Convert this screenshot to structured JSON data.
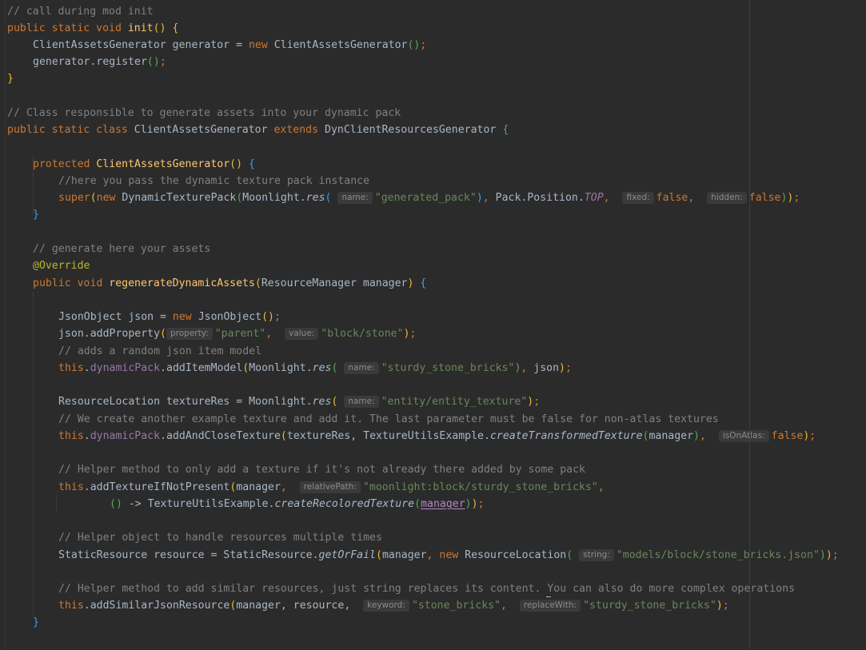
{
  "hints": {
    "name": "name:",
    "fixed": "fixed:",
    "hidden": "hidden:",
    "property": "property:",
    "value": "value:",
    "isOnAtlas": "isOnAtlas:",
    "relativePath": "relativePath:",
    "string": "string:",
    "keyword": "keyword:",
    "replaceWith": "replaceWith:"
  },
  "code": {
    "l1": "// call during mod init",
    "l2_name": "init",
    "l3_class": "ClientAssetsGenerator generator = ",
    "l3_class2": "ClientAssetsGenerator",
    "l4_call": "generator.register",
    "c2": "// Class responsible to generate assets into your dynamic pack",
    "cls_name": "ClientAssetsGenerator",
    "cls_super": "DynClientResourcesGenerator",
    "ctor_name": "ClientAssetsGenerator",
    "c3": "//here you pass the dynamic texture pack instance",
    "dtp": "DynamicTexturePack",
    "moonlight": "Moonlight.",
    "res": "res",
    "gen_pack": "\"generated_pack\"",
    "pack_pos": "Pack.Position.",
    "top": "TOP",
    "c4": "// generate here your assets",
    "override": "@Override",
    "regen": "regenerateDynamicAssets",
    "regen_param": "ResourceManager manager",
    "json_decl": "JsonObject json = ",
    "json_type": "JsonObject",
    "json_add": "json.addProperty",
    "parent": "\"parent\"",
    "block_stone": "\"block/stone\"",
    "c5": "// adds a random json item model",
    "dyn_pack": "dynamicPack",
    "add_item": ".addItemModel",
    "sturdy": "\"sturdy_stone_bricks\"",
    "json_arg": "json",
    "tex_res_decl": "ResourceLocation textureRes = Moonlight.",
    "entity_tex": "\"entity/entity_texture\"",
    "c6": "// We create another example texture and add it. The last parameter must be false for non-atlas textures",
    "add_close": ".addAndCloseTexture",
    "tex_res_arg": "textureRes, TextureUtilsExample.",
    "create_transformed": "createTransformedTexture",
    "manager": "manager",
    "c7": "// Helper method to only add a texture if it's not already there added by some pack",
    "add_if": ".addTextureIfNotPresent",
    "moon_path": "\"moonlight:block/sturdy_stone_bricks\"",
    "lambda_pre": " -> TextureUtilsExample.",
    "create_recolored": "createRecoloredTexture",
    "c8": "// Helper object to handle resources multiple times",
    "static_decl": "StaticResource resource = StaticResource.",
    "get_or_fail": "getOrFail",
    "res_loc": "ResourceLocation",
    "model_path": "\"models/block/stone_bricks.json\"",
    "c9": "// Helper method to add similar resources, just string replaces its content. You can also do more complex operations",
    "add_similar": ".addSimilarJsonResource",
    "manager_resource": "manager, resource, ",
    "stone_bricks": "\"stone_bricks\"",
    "sturdy2": "\"sturdy_stone_bricks\""
  }
}
